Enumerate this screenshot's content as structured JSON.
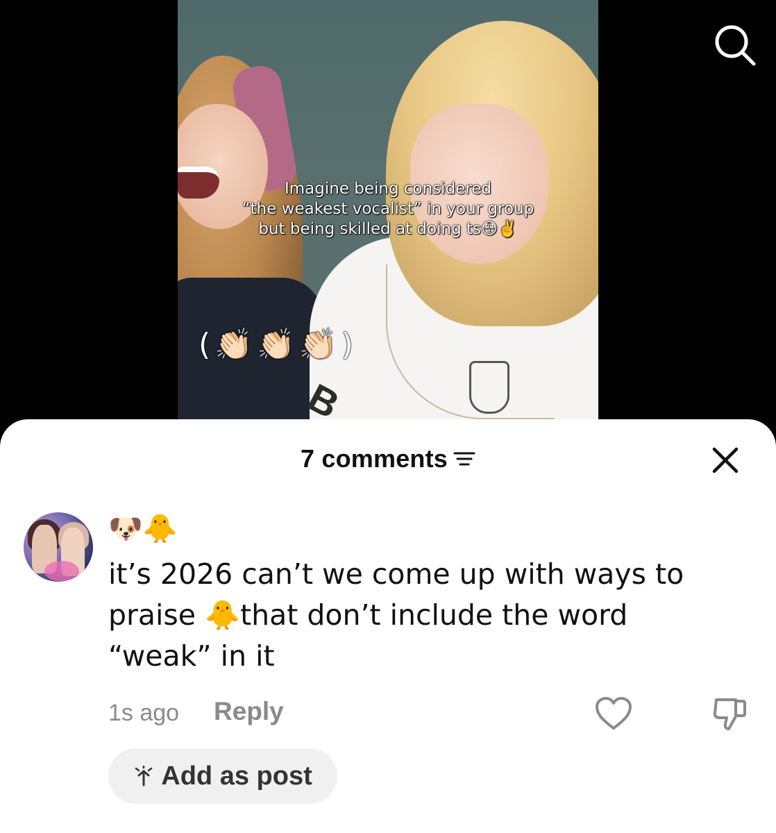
{
  "video": {
    "caption_line1": "Imagine being considered",
    "caption_line2": "“the weakest vocalist” in your group",
    "caption_line3": "but being skilled at doing ts😳✌️",
    "clap_overlay": "(👏🏻👏🏻👏🏻)",
    "shirt_text": "B",
    "search_icon": "search-icon"
  },
  "comments_sheet": {
    "count_label": "7 comments",
    "filter_icon": "filter-icon",
    "close_icon": "close-icon",
    "comment": {
      "username": "🐶🐥",
      "text_line1": "it’s 2026 can’t we come up with ways to",
      "text_line2": "praise 🐥that don’t include the word",
      "text_line3": "“weak” in it",
      "timestamp": "1s ago",
      "reply_label": "Reply",
      "like_icon": "heart-icon",
      "dislike_icon": "thumbs-down-icon"
    },
    "add_post": {
      "label": "Add as post",
      "icon": "sparkle-icon"
    }
  },
  "colors": {
    "sheet_background": "#ffffff",
    "secondary_text": "#8a8a8a",
    "pill_background": "#f0f0f0"
  }
}
